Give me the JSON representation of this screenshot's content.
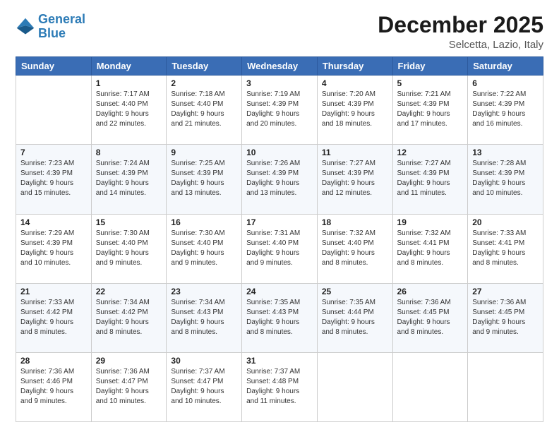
{
  "logo": {
    "line1": "General",
    "line2": "Blue"
  },
  "title": "December 2025",
  "location": "Selcetta, Lazio, Italy",
  "headers": [
    "Sunday",
    "Monday",
    "Tuesday",
    "Wednesday",
    "Thursday",
    "Friday",
    "Saturday"
  ],
  "weeks": [
    [
      {
        "day": "",
        "text": ""
      },
      {
        "day": "1",
        "text": "Sunrise: 7:17 AM\nSunset: 4:40 PM\nDaylight: 9 hours\nand 22 minutes."
      },
      {
        "day": "2",
        "text": "Sunrise: 7:18 AM\nSunset: 4:40 PM\nDaylight: 9 hours\nand 21 minutes."
      },
      {
        "day": "3",
        "text": "Sunrise: 7:19 AM\nSunset: 4:39 PM\nDaylight: 9 hours\nand 20 minutes."
      },
      {
        "day": "4",
        "text": "Sunrise: 7:20 AM\nSunset: 4:39 PM\nDaylight: 9 hours\nand 18 minutes."
      },
      {
        "day": "5",
        "text": "Sunrise: 7:21 AM\nSunset: 4:39 PM\nDaylight: 9 hours\nand 17 minutes."
      },
      {
        "day": "6",
        "text": "Sunrise: 7:22 AM\nSunset: 4:39 PM\nDaylight: 9 hours\nand 16 minutes."
      }
    ],
    [
      {
        "day": "7",
        "text": "Sunrise: 7:23 AM\nSunset: 4:39 PM\nDaylight: 9 hours\nand 15 minutes."
      },
      {
        "day": "8",
        "text": "Sunrise: 7:24 AM\nSunset: 4:39 PM\nDaylight: 9 hours\nand 14 minutes."
      },
      {
        "day": "9",
        "text": "Sunrise: 7:25 AM\nSunset: 4:39 PM\nDaylight: 9 hours\nand 13 minutes."
      },
      {
        "day": "10",
        "text": "Sunrise: 7:26 AM\nSunset: 4:39 PM\nDaylight: 9 hours\nand 13 minutes."
      },
      {
        "day": "11",
        "text": "Sunrise: 7:27 AM\nSunset: 4:39 PM\nDaylight: 9 hours\nand 12 minutes."
      },
      {
        "day": "12",
        "text": "Sunrise: 7:27 AM\nSunset: 4:39 PM\nDaylight: 9 hours\nand 11 minutes."
      },
      {
        "day": "13",
        "text": "Sunrise: 7:28 AM\nSunset: 4:39 PM\nDaylight: 9 hours\nand 10 minutes."
      }
    ],
    [
      {
        "day": "14",
        "text": "Sunrise: 7:29 AM\nSunset: 4:39 PM\nDaylight: 9 hours\nand 10 minutes."
      },
      {
        "day": "15",
        "text": "Sunrise: 7:30 AM\nSunset: 4:40 PM\nDaylight: 9 hours\nand 9 minutes."
      },
      {
        "day": "16",
        "text": "Sunrise: 7:30 AM\nSunset: 4:40 PM\nDaylight: 9 hours\nand 9 minutes."
      },
      {
        "day": "17",
        "text": "Sunrise: 7:31 AM\nSunset: 4:40 PM\nDaylight: 9 hours\nand 9 minutes."
      },
      {
        "day": "18",
        "text": "Sunrise: 7:32 AM\nSunset: 4:40 PM\nDaylight: 9 hours\nand 8 minutes."
      },
      {
        "day": "19",
        "text": "Sunrise: 7:32 AM\nSunset: 4:41 PM\nDaylight: 9 hours\nand 8 minutes."
      },
      {
        "day": "20",
        "text": "Sunrise: 7:33 AM\nSunset: 4:41 PM\nDaylight: 9 hours\nand 8 minutes."
      }
    ],
    [
      {
        "day": "21",
        "text": "Sunrise: 7:33 AM\nSunset: 4:42 PM\nDaylight: 9 hours\nand 8 minutes."
      },
      {
        "day": "22",
        "text": "Sunrise: 7:34 AM\nSunset: 4:42 PM\nDaylight: 9 hours\nand 8 minutes."
      },
      {
        "day": "23",
        "text": "Sunrise: 7:34 AM\nSunset: 4:43 PM\nDaylight: 9 hours\nand 8 minutes."
      },
      {
        "day": "24",
        "text": "Sunrise: 7:35 AM\nSunset: 4:43 PM\nDaylight: 9 hours\nand 8 minutes."
      },
      {
        "day": "25",
        "text": "Sunrise: 7:35 AM\nSunset: 4:44 PM\nDaylight: 9 hours\nand 8 minutes."
      },
      {
        "day": "26",
        "text": "Sunrise: 7:36 AM\nSunset: 4:45 PM\nDaylight: 9 hours\nand 8 minutes."
      },
      {
        "day": "27",
        "text": "Sunrise: 7:36 AM\nSunset: 4:45 PM\nDaylight: 9 hours\nand 9 minutes."
      }
    ],
    [
      {
        "day": "28",
        "text": "Sunrise: 7:36 AM\nSunset: 4:46 PM\nDaylight: 9 hours\nand 9 minutes."
      },
      {
        "day": "29",
        "text": "Sunrise: 7:36 AM\nSunset: 4:47 PM\nDaylight: 9 hours\nand 10 minutes."
      },
      {
        "day": "30",
        "text": "Sunrise: 7:37 AM\nSunset: 4:47 PM\nDaylight: 9 hours\nand 10 minutes."
      },
      {
        "day": "31",
        "text": "Sunrise: 7:37 AM\nSunset: 4:48 PM\nDaylight: 9 hours\nand 11 minutes."
      },
      {
        "day": "",
        "text": ""
      },
      {
        "day": "",
        "text": ""
      },
      {
        "day": "",
        "text": ""
      }
    ]
  ]
}
